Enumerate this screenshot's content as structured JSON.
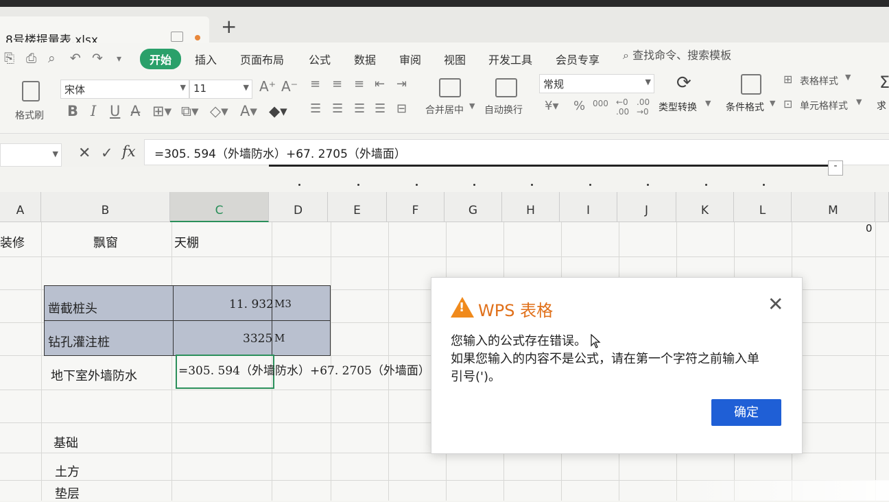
{
  "tab": {
    "title": "8号楼提量表.xlsx"
  },
  "menu": [
    "开始",
    "插入",
    "页面布局",
    "公式",
    "数据",
    "审阅",
    "视图",
    "开发工具",
    "会员专享"
  ],
  "search_placeholder": "查找命令、搜索模板",
  "ribbon": {
    "format_painter": "格式刷",
    "font_name": "宋体",
    "font_size": "11",
    "merge_center": "合并居中",
    "wrap_text": "自动换行",
    "number_format": "常规",
    "type_convert": "类型转换",
    "cond_format": "条件格式",
    "table_style": "表格样式",
    "cell_style": "单元格样式",
    "sum_partial": "求"
  },
  "formula_bar": {
    "formula": "=305. 594（外墙防水）+67. 2705（外墙面）"
  },
  "columns": [
    "A",
    "B",
    "C",
    "D",
    "E",
    "F",
    "G",
    "H",
    "I",
    "J",
    "K",
    "L",
    "M"
  ],
  "cells": {
    "a_zhuangxiu": "装修",
    "b_piaochuang": "飘窗",
    "c_tianpeng": "天棚",
    "m_zero": "0",
    "b_zaojie": "凿截桩头",
    "c_zaojie": "11. 932",
    "d_zaojie": "M3",
    "b_zuankong": "钻孔灌注桩",
    "c_zuankong": "3325",
    "d_zuankong": "M",
    "b_dixiashi": "地下室外墙防水",
    "c_dixiashi": "=305. 594（外墙防水）+67. 2705（外墙面）",
    "b_jichu": "基础",
    "b_tufang": "土方",
    "b_dianceng": "垫层"
  },
  "dialog": {
    "title": "WPS 表格",
    "line1": "您输入的公式存在错误。",
    "line2": "如果您输入的内容不是公式，请在第一个字符之前输入单",
    "line3": "引号(')。",
    "ok": "确定"
  },
  "colors": {
    "accent_green": "#2aa06a",
    "ok_blue": "#1f5fd6",
    "warn_orange": "#f08a1c"
  }
}
